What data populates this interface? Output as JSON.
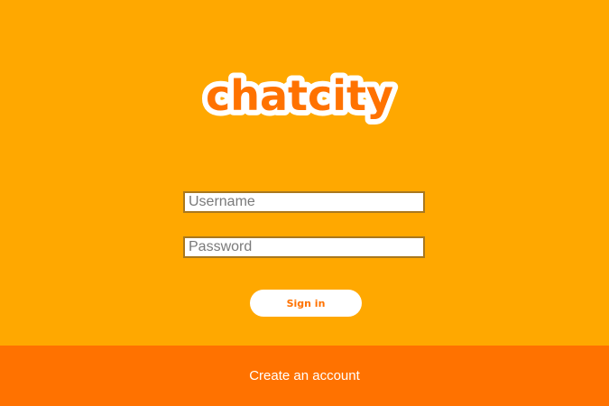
{
  "app": {
    "logo_text": "chatcity"
  },
  "form": {
    "username_placeholder": "Username",
    "username_value": "",
    "password_placeholder": "Password",
    "password_value": "",
    "signin_label": "Sign in"
  },
  "footer": {
    "create_account_label": "Create an account"
  },
  "colors": {
    "background": "#FFA800",
    "accent": "#FF7200",
    "field_border": "#A9781E",
    "button_bg": "#FFFFFF"
  }
}
